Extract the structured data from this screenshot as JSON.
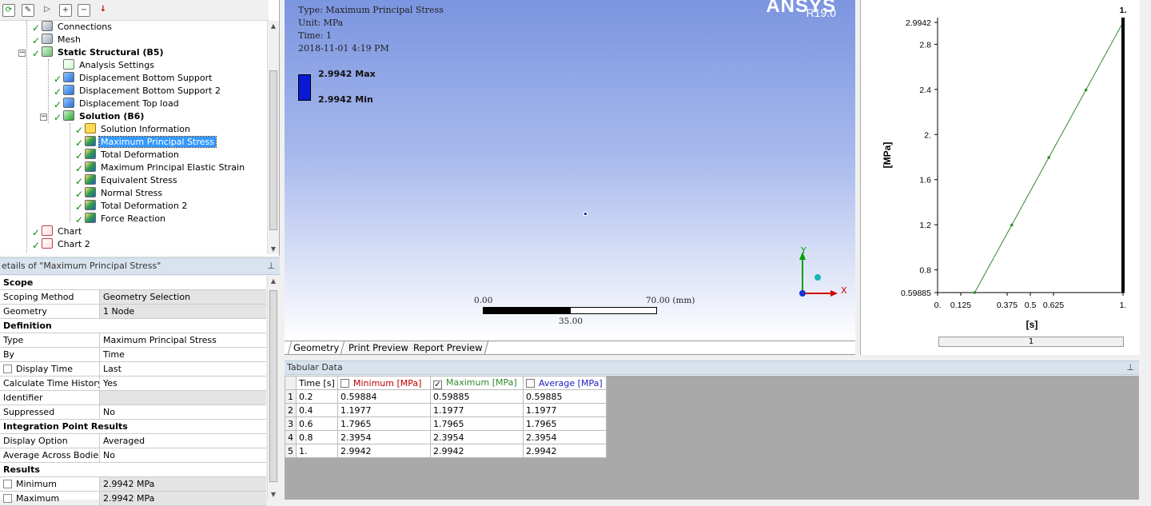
{
  "tree": {
    "items": [
      {
        "label": "Connections"
      },
      {
        "label": "Mesh"
      },
      {
        "label": "Static Structural (B5)"
      },
      {
        "label": "Analysis Settings"
      },
      {
        "label": "Displacement Bottom Support"
      },
      {
        "label": "Displacement Bottom Support 2"
      },
      {
        "label": "Displacement Top load"
      },
      {
        "label": "Solution (B6)"
      },
      {
        "label": "Solution Information"
      },
      {
        "label": "Maximum Principal Stress"
      },
      {
        "label": "Total Deformation"
      },
      {
        "label": "Maximum Principal Elastic Strain"
      },
      {
        "label": "Equivalent Stress"
      },
      {
        "label": "Normal Stress"
      },
      {
        "label": "Total Deformation 2"
      },
      {
        "label": "Force Reaction"
      },
      {
        "label": "Chart"
      },
      {
        "label": "Chart 2"
      }
    ]
  },
  "details": {
    "title": "etails of \"Maximum Principal Stress\"",
    "rows": [
      {
        "k": "Scope",
        "v": ""
      },
      {
        "k": "Scoping Method",
        "v": "Geometry Selection"
      },
      {
        "k": "Geometry",
        "v": "1 Node"
      },
      {
        "k": "Definition",
        "v": ""
      },
      {
        "k": "Type",
        "v": "Maximum Principal Stress"
      },
      {
        "k": "By",
        "v": "Time"
      },
      {
        "k": "Display Time",
        "v": "Last"
      },
      {
        "k": "Calculate Time History",
        "v": "Yes"
      },
      {
        "k": "Identifier",
        "v": ""
      },
      {
        "k": "Suppressed",
        "v": "No"
      },
      {
        "k": "Integration Point Results",
        "v": ""
      },
      {
        "k": "Display Option",
        "v": "Averaged"
      },
      {
        "k": "Average Across Bodies",
        "v": "No"
      },
      {
        "k": "Results",
        "v": ""
      },
      {
        "k": "Minimum",
        "v": "2.9942 MPa"
      },
      {
        "k": "Maximum",
        "v": "2.9942 MPa"
      }
    ]
  },
  "viewport": {
    "type_line": "Type: Maximum Principal Stress",
    "unit_line": "Unit: MPa",
    "time_line": "Time: 1",
    "date_line": "2018-11-01 4:19 PM",
    "legend_max": "2.9942 Max",
    "legend_min": "2.9942 Min",
    "logo": "ANSYS",
    "version": "R19.0",
    "scale_left": "0.00",
    "scale_right": "70.00 (mm)",
    "scale_mid": "35.00",
    "axis_y": "Y",
    "axis_x": "X",
    "tabs": [
      "Geometry",
      "Print Preview",
      "Report Preview"
    ]
  },
  "chart_data": {
    "type": "line",
    "x": [
      0.2,
      0.4,
      0.6,
      0.8,
      1.0
    ],
    "series": [
      {
        "values": [
          0.59885,
          1.1977,
          1.7965,
          2.3954,
          2.9942
        ]
      }
    ],
    "xlabel": "[s]",
    "ylabel": "[MPa]",
    "xlim": [
      0,
      1
    ],
    "ylim": [
      0.59885,
      2.9942
    ],
    "xticks": [
      "0.",
      "0.125",
      "0.375",
      "0.5",
      "0.625",
      "1."
    ],
    "yticks": [
      "0.59885",
      "0.8",
      "1.2",
      "1.6",
      "2.",
      "2.4",
      "2.8",
      "2.9942"
    ],
    "marker_label": "1.",
    "slider_value": "1",
    "series_color": "#2e8b2e"
  },
  "tabular": {
    "title": "Tabular Data",
    "headers": [
      "Time [s]",
      "Minimum [MPa]",
      "Maximum [MPa]",
      "Average [MPa]"
    ],
    "header_colors": [
      "#000000",
      "#c00000",
      "#2e8b2e",
      "#2020c0"
    ],
    "rows": [
      [
        "1",
        "0.2",
        "0.59884",
        "0.59885",
        "0.59885"
      ],
      [
        "2",
        "0.4",
        "1.1977",
        "1.1977",
        "1.1977"
      ],
      [
        "3",
        "0.6",
        "1.7965",
        "1.7965",
        "1.7965"
      ],
      [
        "4",
        "0.8",
        "2.3954",
        "2.3954",
        "2.3954"
      ],
      [
        "5",
        "1.",
        "2.9942",
        "2.9942",
        "2.9942"
      ]
    ]
  }
}
